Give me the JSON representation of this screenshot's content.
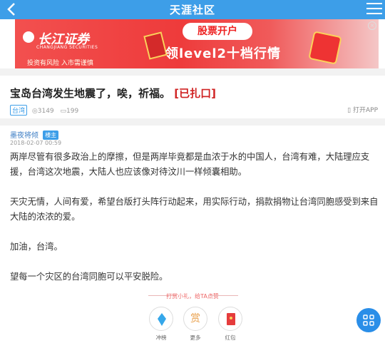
{
  "header": {
    "title": "天涯社区",
    "back_icon": "chevron-left-icon",
    "menu_icon": "hamburger-icon",
    "color": "#3d9ee8"
  },
  "ad": {
    "brand": "长江证券",
    "brand_en": "CHANGJIANG SECURITIES",
    "risk_notice": "投资有风险  入市需谨慎",
    "pill": "股票开户",
    "headline": "领level2十档行情"
  },
  "post": {
    "title": "宝岛台湾发生地震了，唉，祈福。",
    "closed_tag": "[已扎口]",
    "board_tag": "台湾",
    "views": "3149",
    "comments": "199",
    "open_app": "打开APP"
  },
  "author": {
    "name": "墨夜将倾",
    "badge": "楼主",
    "date": "2018-02-07 00:59"
  },
  "content": [
    "两岸尽管有很多政治上的摩擦，但是两岸毕竟都是血浓于水的中国人，台湾有难，大陆理应支援，台湾这次地震，大陆人也应该像对待汶川一样倾囊相助。",
    "天灾无情，人间有爱，希望台版打头阵行动起来，用实际行动，捐款捐物让台湾同胞感受到来自大陆的浓浓的爱。",
    "加油，台湾。",
    "望每一个灾区的台湾同胞可以平安脱险。"
  ],
  "reward": {
    "title": "打赏小礼，给TA点赞",
    "items": [
      {
        "label": "冲榜",
        "icon": "diamond-icon"
      },
      {
        "label": "更多",
        "icon": "reward-icon",
        "glyph": "赏"
      },
      {
        "label": "红包",
        "icon": "red-packet-icon"
      }
    ]
  },
  "float_button_icon": "grid-icon"
}
